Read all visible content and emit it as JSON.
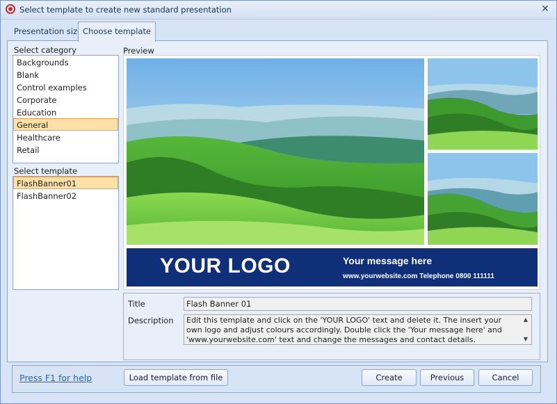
{
  "window": {
    "title": "Select template to create new standard presentation"
  },
  "tabs": [
    {
      "label": "Presentation size"
    },
    {
      "label": "Choose template"
    }
  ],
  "category": {
    "label": "Select category",
    "items": [
      "Backgrounds",
      "Blank",
      "Control examples",
      "Corporate",
      "Education",
      "General",
      "Healthcare",
      "Retail"
    ],
    "selected": "General"
  },
  "template": {
    "label": "Select template",
    "items": [
      "FlashBanner01",
      "FlashBanner02"
    ],
    "selected": "FlashBanner01"
  },
  "preview": {
    "label": "Preview",
    "banner": {
      "logo": "YOUR LOGO",
      "message": "Your message here",
      "contact": "www.yourwebsite.com  Telephone 0800 111111"
    }
  },
  "info": {
    "title_label": "Title",
    "title_value": "Flash Banner 01",
    "description_label": "Description",
    "description_value": "Edit this template and click on the 'YOUR LOGO' text and delete it.  The insert your own logo and adjust colours accordingly.  Double click the 'Your message here' and 'www.yourwebsite.com' text and change the messages and contact details."
  },
  "footer": {
    "help": "Press F1 for help",
    "load": "Load template from file",
    "create": "Create",
    "previous": "Previous",
    "cancel": "Cancel"
  },
  "colors": {
    "banner": "#0f2f78",
    "selection": "#ffe0a6",
    "link": "#2466c6"
  },
  "icons": {
    "app": "presentation-app-icon",
    "close": "close-icon"
  }
}
